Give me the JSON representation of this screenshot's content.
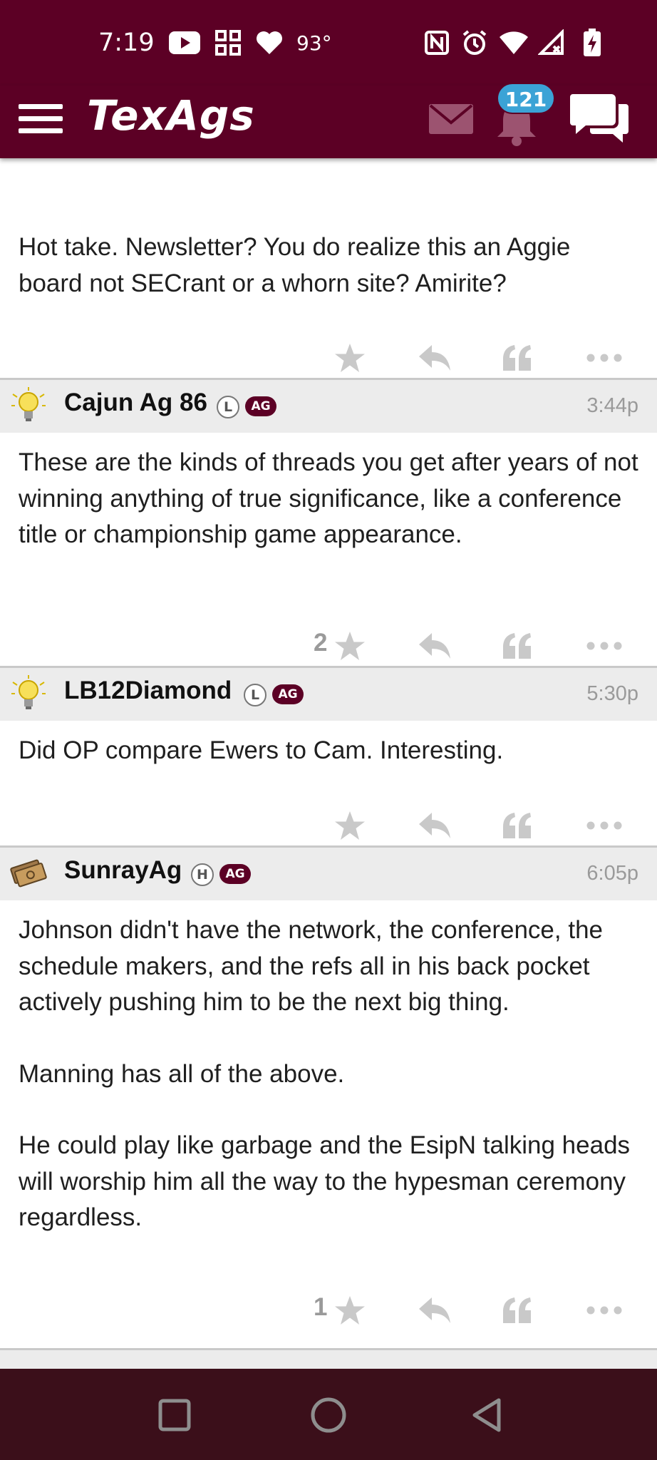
{
  "status_bar": {
    "time": "7:19",
    "temperature": "93°",
    "icons": [
      "youtube-icon",
      "widgets-icon",
      "heart-icon",
      "nfc-icon",
      "alarm-icon",
      "wifi-icon",
      "signal-icon",
      "battery-charging-icon"
    ]
  },
  "app_bar": {
    "logo": "TexAgs",
    "notification_count": "121",
    "colors": {
      "maroon": "#5c0025",
      "badge_blue": "#3ba3d6"
    }
  },
  "posts": [
    {
      "body": "Hot take. Newsletter? You do realize this an Aggie board not SECrant or a whorn site? Amirite?",
      "star_count": ""
    },
    {
      "username": "Cajun Ag 86",
      "status_letter": "L",
      "ag_badge": "AG",
      "time": "3:44p",
      "avatar": "lightbulb-icon",
      "body": "These are the kinds of threads you get after years of not winning anything of true significance, like a conference title or championship game appearance.",
      "star_count": "2"
    },
    {
      "username": "LB12Diamond",
      "status_letter": "L",
      "ag_badge": "AG",
      "time": "5:30p",
      "avatar": "lightbulb-icon",
      "body": "Did OP compare Ewers to Cam. Interesting.",
      "star_count": ""
    },
    {
      "username": "SunrayAg",
      "status_letter": "H",
      "ag_badge": "AG",
      "time": "6:05p",
      "avatar": "cash-icon",
      "body_paragraphs": [
        "Johnson didn't have the network, the conference, the schedule makers, and the refs all in his back pocket actively pushing him to be the next big thing.",
        "Manning has all of the above.",
        "He could play like garbage and the EsipN talking heads will worship him all the way to the hypesman ceremony regardless."
      ],
      "star_count": "1"
    }
  ],
  "nav_bar": {
    "buttons": [
      "recents-button",
      "home-button",
      "back-button"
    ]
  }
}
